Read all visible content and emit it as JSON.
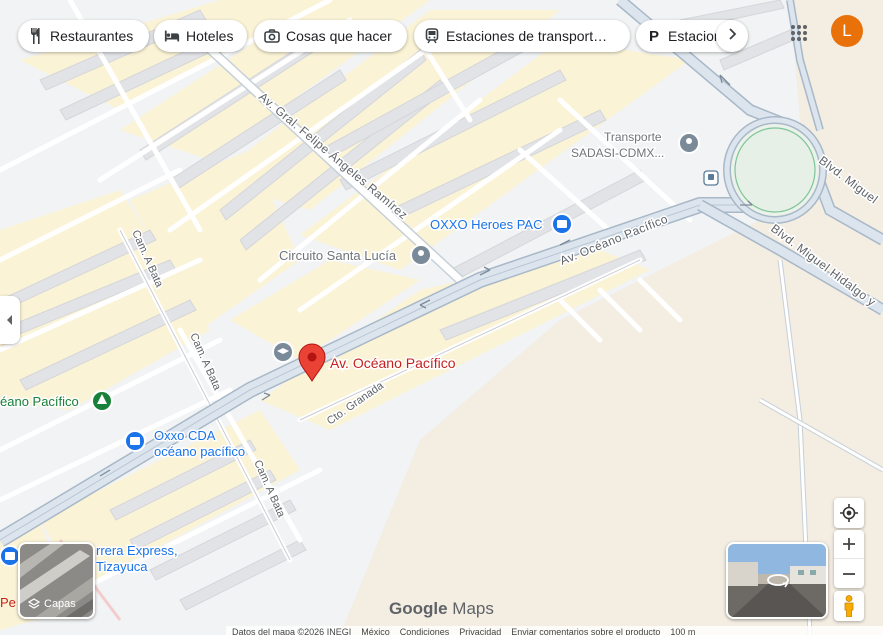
{
  "chips": [
    {
      "label": "Restaurantes",
      "icon": "fork-knife-icon"
    },
    {
      "label": "Hoteles",
      "icon": "bed-icon"
    },
    {
      "label": "Cosas que hacer",
      "icon": "camera-icon"
    },
    {
      "label": "Estaciones de transport…",
      "icon": "train-icon"
    },
    {
      "label": "Estacion",
      "icon": "parking-icon"
    }
  ],
  "avatar_letter": "L",
  "streets": {
    "felipe_angeles": "Av. Gral. Felipe Ángeles Ramírez",
    "oceano_pacifico_main": "Av. Océano Pacífico",
    "blvd_miguel_1": "Blvd. Miguel",
    "blvd_miguel_2": "Blvd. Miguel Hidalgo y",
    "cam_a_bata": "Cam. A Bata",
    "cto_granada": "Cto. Granada"
  },
  "places": {
    "transporte_line1": "Transporte",
    "transporte_line2": "SADASI-CDMX...",
    "oxxo_heroes": "OXXO Heroes PAC",
    "circuito_santa_lucia": "Circuito Santa Lucía",
    "selected_pin": "Av. Océano Pacífico",
    "park_oceano": "éano Pacífico",
    "oxxo_cda_line1": "Oxxo CDA",
    "oxxo_cda_line2": "océano pacífico",
    "carrera_line1": "rrera Express,",
    "carrera_line2": "Tizayuca",
    "left_cut": "Pe"
  },
  "layers_label": "Capas",
  "logo": {
    "brand": "Google",
    "product": "Maps"
  },
  "footer": [
    "Datos del mapa ©2026 INEGI",
    "México",
    "Condiciones",
    "Privacidad",
    "Enviar comentarios sobre el producto",
    "100 m"
  ],
  "colors": {
    "pin_red": "#ea4335",
    "place_blue": "#1a73e8",
    "park_green": "#188038",
    "avatar_orange": "#e8710a",
    "label_red": "#c5221f"
  }
}
